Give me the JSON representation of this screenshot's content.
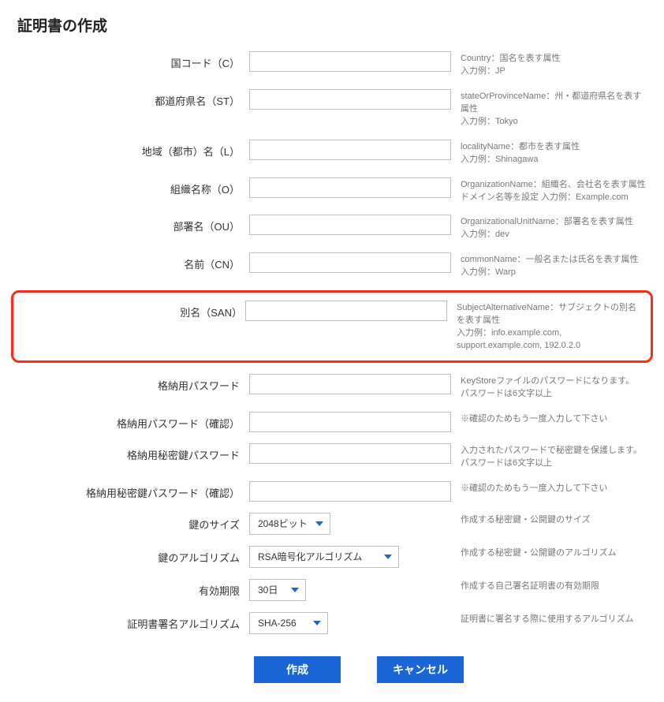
{
  "title": "証明書の作成",
  "fields": {
    "country": {
      "label": "国コード（C）",
      "hint": "Country：国名を表す属性\n入力例：JP"
    },
    "state": {
      "label": "都道府県名（ST）",
      "hint": "stateOrProvinceName：州・都道府県名を表す属性\n入力例：Tokyo"
    },
    "locality": {
      "label": "地域（都市）名（L）",
      "hint": "localityName：都市を表す属性\n入力例：Shinagawa"
    },
    "org": {
      "label": "組織名称（O）",
      "hint": "OrganizationName：組織名、会社名を表す属性\nドメイン名等を設定 入力例：Example.com"
    },
    "ou": {
      "label": "部署名（OU）",
      "hint": "OrganizationalUnitName：部署名を表す属性\n入力例：dev"
    },
    "cn": {
      "label": "名前（CN）",
      "hint": "commonName：一般名または氏名を表す属性\n入力例：Warp"
    },
    "san": {
      "label": "別名（SAN）",
      "hint": "SubjectAlternativeName：サブジェクトの別名を表す属性\n入力例：info.example.com, support.example.com, 192.0.2.0"
    },
    "kspass": {
      "label": "格納用パスワード",
      "hint": "KeyStoreファイルのパスワードになります。\nパスワードは6文字以上"
    },
    "kspass2": {
      "label": "格納用パスワード（確認）",
      "hint": "※確認のためもう一度入力して下さい"
    },
    "pkpass": {
      "label": "格納用秘密鍵パスワード",
      "hint": "入力されたパスワードで秘密鍵を保護します。\nパスワードは6文字以上"
    },
    "pkpass2": {
      "label": "格納用秘密鍵パスワード（確認）",
      "hint": "※確認のためもう一度入力して下さい"
    },
    "keysize": {
      "label": "鍵のサイズ",
      "value": "2048ビット",
      "hint": "作成する秘密鍵・公開鍵のサイズ"
    },
    "keyalgo": {
      "label": "鍵のアルゴリズム",
      "value": "RSA暗号化アルゴリズム",
      "hint": "作成する秘密鍵・公開鍵のアルゴリズム"
    },
    "validity": {
      "label": "有効期限",
      "value": "30日",
      "hint": "作成する自己署名証明書の有効期限"
    },
    "sigalgo": {
      "label": "証明書署名アルゴリズム",
      "value": "SHA-256",
      "hint": "証明書に署名する際に使用するアルゴリズム"
    }
  },
  "buttons": {
    "create": "作成",
    "cancel": "キャンセル"
  }
}
